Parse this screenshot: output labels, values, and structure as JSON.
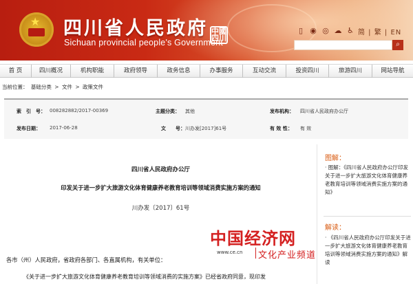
{
  "header": {
    "title_cn": "四川省人民政府",
    "title_en": "Sichuan provincial people's Government",
    "seal_text": "中國四川",
    "lang_switch": "简 | 繁 | EN",
    "search_placeholder": "",
    "icons": [
      "phone-icon",
      "weibo-icon",
      "wechat-icon",
      "cloud-icon",
      "accessibility-icon"
    ]
  },
  "nav": {
    "items": [
      "首 页",
      "四川概况",
      "机构职能",
      "政府领导",
      "政务信息",
      "办事服务",
      "互动交流",
      "投资四川",
      "旅游四川",
      "网站导航"
    ]
  },
  "breadcrumb": {
    "prefix": "当前位置：",
    "items": [
      "基础分类",
      "文件",
      "政策文件"
    ],
    "separator": ">"
  },
  "info": {
    "index_label": "索　引　号：",
    "index_value": "008282882/2017-00369",
    "topic_label": "主题分类：",
    "topic_value": "其他",
    "issuer_label": "发布机构：",
    "issuer_value": "四川省人民政府办公厅",
    "date_label": "发布日期：",
    "date_value": "2017-06-28",
    "docno_label": "文　　号：",
    "docno_value": "川办发[2017]61号",
    "valid_label": "有 效 性：",
    "valid_value": "有 效"
  },
  "document": {
    "issuer": "四川省人民政府办公厅",
    "title": "印发关于进一步扩大旅游文化体育健康养老教育培训等领域消费实施方案的通知",
    "doc_number": "川办发〔2017〕61号",
    "para1": "各市（州）人民政府，省政府各部门、各直属机构，有关单位：",
    "para2": "《关于进一步扩大旅游文化体育健康养老教育培训等领域消费的实施方案》已经省政府同意，现印发"
  },
  "watermark": {
    "cn": "中国经济网",
    "url": "www.ce.cn",
    "sub": "文化产业频道"
  },
  "side": {
    "head1": "图解：",
    "item1": "· 图解：《四川省人民政府办公厅印发关于进一步扩大旅游文化体育健康养老教育培训等领域消费实施方案的通知》",
    "head2": "解读：",
    "item2": "· 《四川省人民政府办公厅印发关于进一步扩大旅游文化体育健康养老教育培训等领域消费实施方案的通知》解读"
  },
  "colors": {
    "banner_red": "#c92a14",
    "accent_orange": "#d85a10",
    "watermark_red": "#d42020"
  }
}
